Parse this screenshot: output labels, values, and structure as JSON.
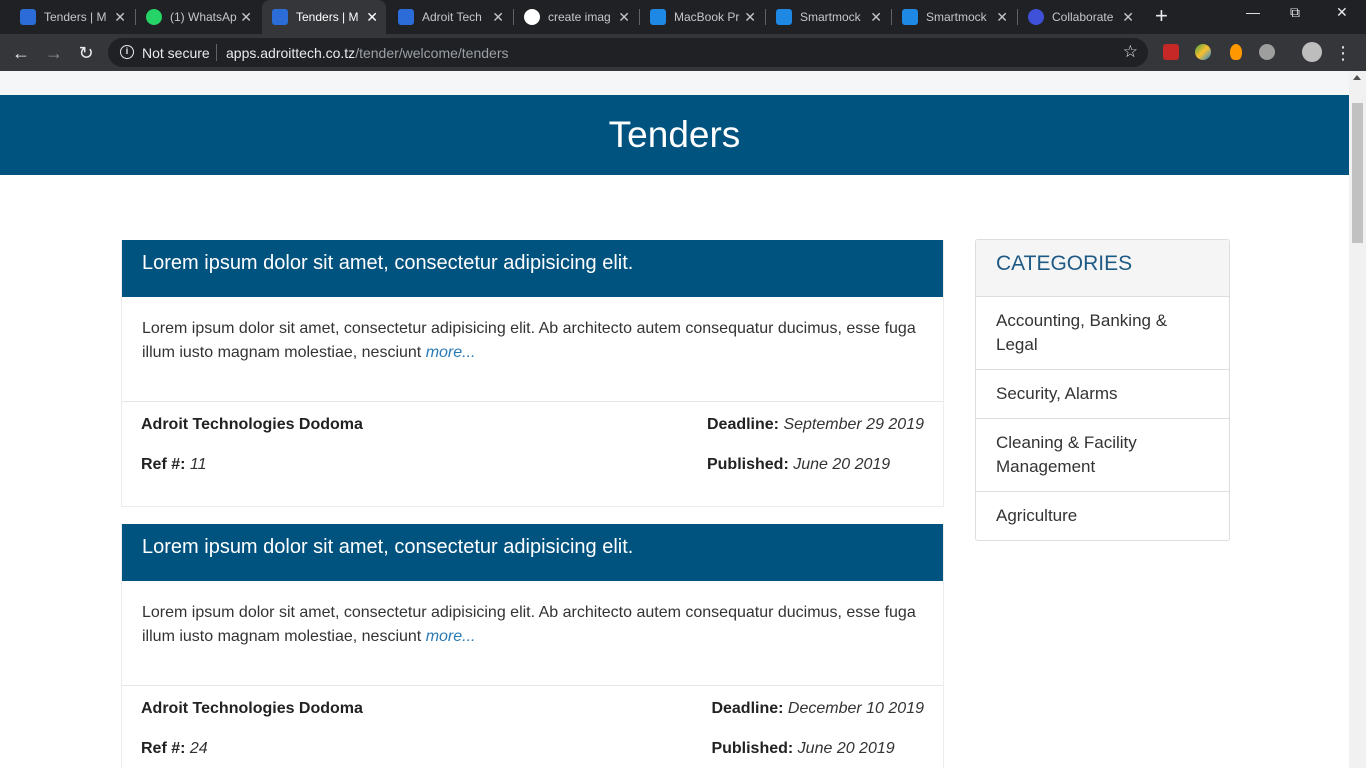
{
  "browser": {
    "tabs": [
      {
        "label": "Tenders | M",
        "favicon": "adroit-icon",
        "color": "#2b6cd8"
      },
      {
        "label": "(1) WhatsAp",
        "favicon": "whatsapp-icon",
        "color": "#25d366"
      },
      {
        "label": "Tenders | M",
        "favicon": "adroit-icon",
        "color": "#2b6cd8"
      },
      {
        "label": "Adroit Tech",
        "favicon": "adroit-icon",
        "color": "#2b6cd8"
      },
      {
        "label": "create imag",
        "favicon": "google-icon",
        "color": "#ffffff"
      },
      {
        "label": "MacBook Pr",
        "favicon": "smartmockups-icon",
        "color": "#1e88e5"
      },
      {
        "label": "Smartmock",
        "favicon": "smartmockups-icon",
        "color": "#1e88e5"
      },
      {
        "label": "Smartmock",
        "favicon": "smartmockups-icon",
        "color": "#1e88e5"
      },
      {
        "label": "Collaborate",
        "favicon": "canva-icon",
        "color": "#3f51d8"
      }
    ],
    "active_tab_index": 2,
    "new_tab_symbol": "+",
    "window_buttons": {
      "minimize": "—",
      "restore": "⧉",
      "close": "✕"
    },
    "security_label": "Not secure",
    "url_host": "apps.adroittech.co.tz",
    "url_path": "/tender/welcome/tenders"
  },
  "page": {
    "title": "Tenders",
    "tenders": [
      {
        "title": "Lorem ipsum dolor sit amet, consectetur adipisicing elit.",
        "summary": "Lorem ipsum dolor sit amet, consectetur adipisicing elit. Ab architecto autem consequatur ducimus, esse fuga illum iusto magnam molestiae, nesciunt",
        "more_label": "more...",
        "company": "Adroit Technologies Dodoma",
        "ref_label": "Ref #:",
        "ref": "11",
        "deadline_label": "Deadline:",
        "deadline": "September 29 2019",
        "published_label": "Published:",
        "published": "June 20 2019"
      },
      {
        "title": "Lorem ipsum dolor sit amet, consectetur adipisicing elit.",
        "summary": "Lorem ipsum dolor sit amet, consectetur adipisicing elit. Ab architecto autem consequatur ducimus, esse fuga illum iusto magnam molestiae, nesciunt",
        "more_label": "more...",
        "company": "Adroit Technologies Dodoma",
        "ref_label": "Ref #:",
        "ref": "24",
        "deadline_label": "Deadline:",
        "deadline": "December 10 2019",
        "published_label": "Published:",
        "published": "June 20 2019"
      }
    ],
    "categories_heading": "CATEGORIES",
    "categories": [
      "Accounting, Banking & Legal",
      "Security, Alarms",
      "Cleaning & Facility Management",
      "Agriculture"
    ]
  },
  "colors": {
    "brand_blue": "#00527f",
    "link_blue": "#2a7ab5"
  }
}
